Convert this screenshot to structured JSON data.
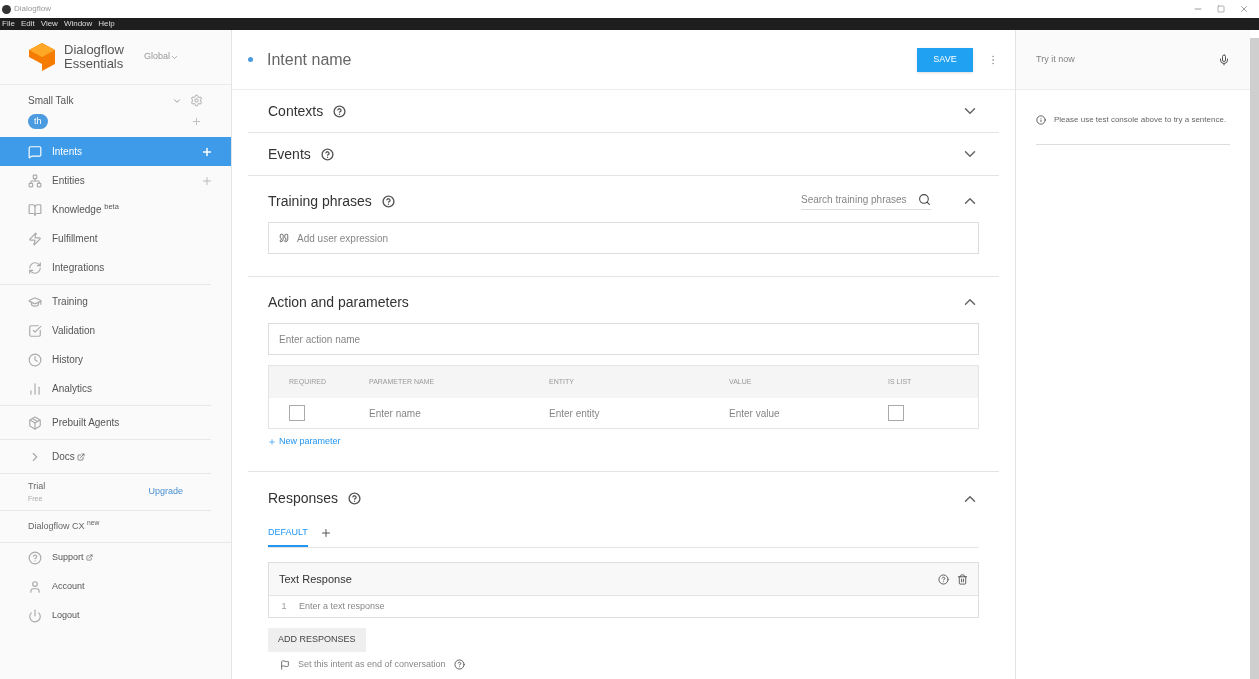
{
  "window": {
    "title": "Dialogflow",
    "menu": [
      "File",
      "Edit",
      "View",
      "Window",
      "Help"
    ]
  },
  "sidebar": {
    "brand": {
      "line1": "Dialogflow",
      "line2": "Essentials",
      "region": "Global"
    },
    "agent": {
      "name": "Small Talk",
      "language": "th"
    },
    "groups": [
      [
        {
          "label": "Intents",
          "selected": true,
          "add": true
        },
        {
          "label": "Entities",
          "selected": false,
          "add": true
        },
        {
          "label": "Knowledge $^{beta}$",
          "selected": false,
          "add": false
        },
        {
          "label": "Fulfillment",
          "selected": false,
          "add": false
        },
        {
          "label": "Integrations",
          "selected": false,
          "add": false
        }
      ],
      [
        {
          "label": "Training",
          "selected": false,
          "add": false
        },
        {
          "label": "Validation",
          "selected": false,
          "add": false
        },
        {
          "label": "History",
          "selected": false,
          "add": false
        },
        {
          "label": "Analytics",
          "selected": false,
          "add": false
        }
      ],
      [
        {
          "label": "Prebuilt Agents",
          "selected": false,
          "add": false
        }
      ],
      [
        {
          "label": "Docs",
          "selected": false,
          "add": false
        }
      ]
    ],
    "plan": {
      "name": "Trial",
      "tier": "Free",
      "action": "Upgrade"
    },
    "cx": "Dialogflow CX $^{new}$",
    "footer": [
      {
        "label": "Support"
      },
      {
        "label": "Account"
      },
      {
        "label": "Logout"
      }
    ]
  },
  "intent": {
    "placeholder": "Intent name",
    "save": "SAVE"
  },
  "sections": [
    {
      "kind": "collapsed",
      "title": "Contexts",
      "help": true,
      "expanded": false
    },
    {
      "kind": "collapsed",
      "title": "Events",
      "help": true,
      "expanded": false
    },
    {
      "kind": "training",
      "title": "Training phrases",
      "help": true,
      "expanded": true,
      "search_placeholder": "Search training phrases",
      "input_placeholder": "Add user expression"
    },
    {
      "kind": "action",
      "title": "Action and parameters",
      "help": false,
      "expanded": true,
      "input_placeholder": "Enter action name",
      "columns": [
        "REQUIRED",
        "PARAMETER NAME",
        "ENTITY",
        "VALUE",
        "IS LIST"
      ],
      "row": {
        "required": false,
        "name_placeholder": "Enter name",
        "entity_placeholder": "Enter entity",
        "value_placeholder": "Enter value",
        "is_list": false
      },
      "link": "New parameter"
    },
    {
      "kind": "responses",
      "title": "Responses",
      "help": true,
      "expanded": true,
      "tabs": [
        {
          "label": "DEFAULT",
          "selected": true
        }
      ],
      "card_title": "Text Response",
      "row_number": "1",
      "input_placeholder": "Enter a text response",
      "add": "ADD RESPONSES",
      "end_label": "Set this intent as end of conversation"
    }
  ],
  "console": {
    "placeholder": "Try it now",
    "message": "Please use test console above to try a sentence."
  }
}
